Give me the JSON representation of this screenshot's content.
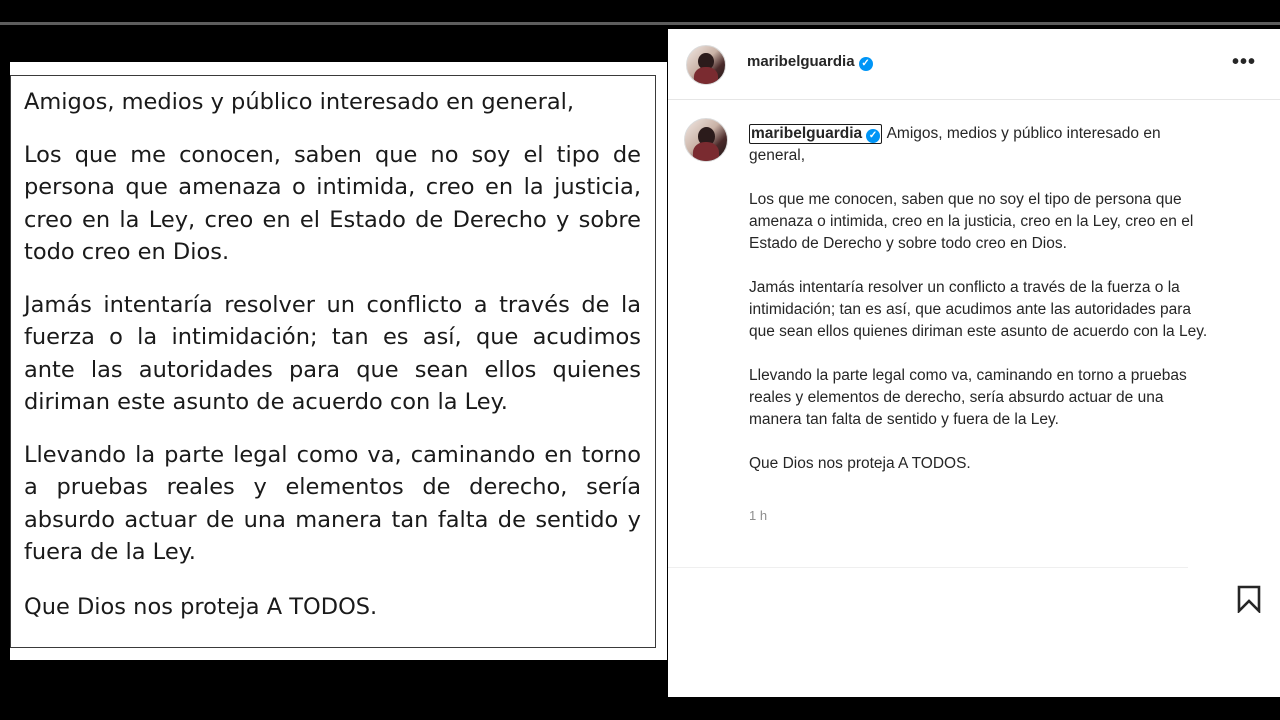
{
  "document_image": {
    "greeting": "Amigos, medios y público interesado en general,",
    "paragraphs": [
      "Los que me conocen, saben que no soy el tipo de persona que amenaza o intimida, creo en la justicia, creo en la Ley, creo en el Estado de Derecho y sobre todo creo en Dios.",
      "Jamás intentaría resolver un conflicto a través de la fuerza o la intimidación; tan es así, que acudimos ante las autoridades para que sean ellos quienes diriman este asunto de acuerdo con la Ley.",
      "Llevando la parte legal como va, caminando en torno a pruebas reales y elementos de derecho, sería absurdo actuar de una manera tan falta de sentido y fuera de la Ley."
    ],
    "closing": "Que Dios nos proteja A TODOS."
  },
  "instagram": {
    "header": {
      "username": "maribelguardia",
      "verified": true,
      "more_icon": "more-horizontal-icon"
    },
    "caption": {
      "username": "maribelguardia",
      "first_line": "Amigos, medios y público interesado en general,",
      "paragraphs": [
        "Los que me conocen, saben que no soy el tipo de persona que amenaza o intimida, creo en la justicia, creo en la Ley, creo en el Estado de Derecho y sobre todo creo en Dios.",
        "Jamás intentaría resolver un conflicto a través de la fuerza o la intimidación; tan es así, que acudimos ante las autoridades para que sean ellos quienes diriman este asunto de acuerdo con la Ley.",
        "Llevando la parte legal como va, caminando en torno a pruebas reales y elementos de derecho, sería absurdo actuar de una manera tan falta de sentido y fuera de la Ley.",
        "Que Dios nos proteja A TODOS."
      ],
      "timestamp": "1 h"
    },
    "actions": {
      "save_icon": "bookmark-icon"
    },
    "colors": {
      "verified_badge": "#0095f6",
      "text": "#262626",
      "muted": "#8e8e8e"
    }
  }
}
